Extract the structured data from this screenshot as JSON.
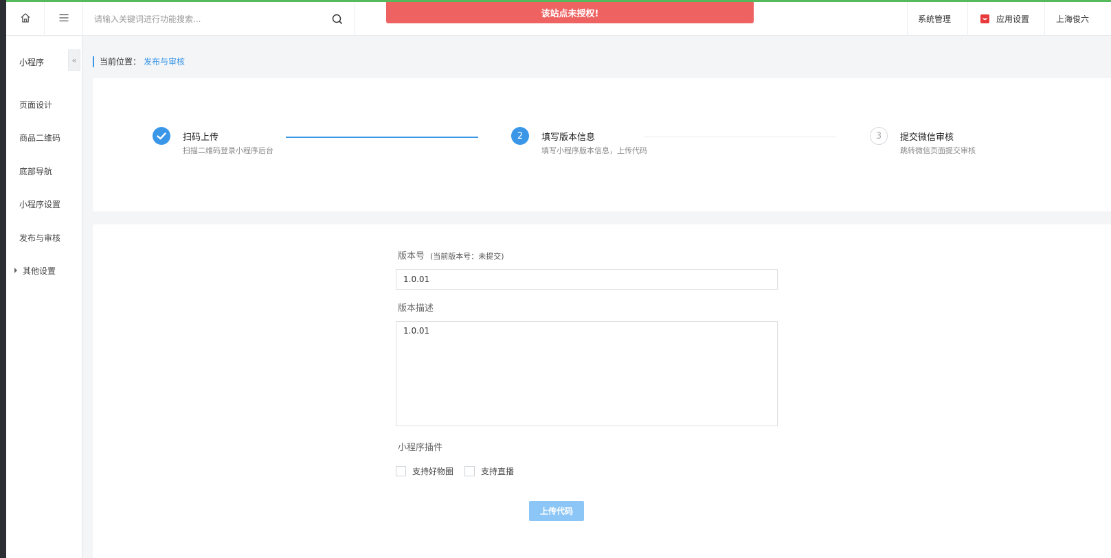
{
  "header": {
    "search_placeholder": "请输入关键词进行功能搜索...",
    "alert": "该站点未授权!",
    "menu": {
      "system": "系统管理",
      "app_settings": "应用设置",
      "org": "上海俊六"
    },
    "icons": {
      "home": "home-icon",
      "menu": "menu-icon",
      "search": "search-icon",
      "app_settings": "red-bag-icon"
    }
  },
  "sidebar": {
    "title": "小程序",
    "collapse_glyph": "«",
    "items": [
      {
        "label": "页面设计"
      },
      {
        "label": "商品二维码"
      },
      {
        "label": "底部导航"
      },
      {
        "label": "小程序设置"
      },
      {
        "label": "发布与审核"
      },
      {
        "label": "其他设置"
      }
    ]
  },
  "breadcrumb": {
    "prefix": "当前位置：",
    "current": "发布与审核"
  },
  "steps": [
    {
      "number": "1",
      "title": "扫码上传",
      "desc": "扫描二维码登录小程序后台",
      "state": "done"
    },
    {
      "number": "2",
      "title": "填写版本信息",
      "desc": "填写小程序版本信息，上传代码",
      "state": "active"
    },
    {
      "number": "3",
      "title": "提交微信审核",
      "desc": "跳转微信页面提交审核",
      "state": "todo"
    }
  ],
  "form": {
    "version_label": "版本号",
    "version_hint": "(当前版本号：未提交)",
    "version_value": "1.0.01",
    "desc_label": "版本描述",
    "desc_value": "1.0.01",
    "plugins_label": "小程序插件",
    "plugin_options": [
      {
        "label": "支持好物圈",
        "checked": false
      },
      {
        "label": "支持直播",
        "checked": false
      }
    ],
    "submit_label": "上传代码"
  },
  "colors": {
    "accent": "#3a97e8",
    "alert_bg": "#ee6262",
    "top_bar": "#56b95c",
    "submit_disabled": "#8cc6f6"
  }
}
